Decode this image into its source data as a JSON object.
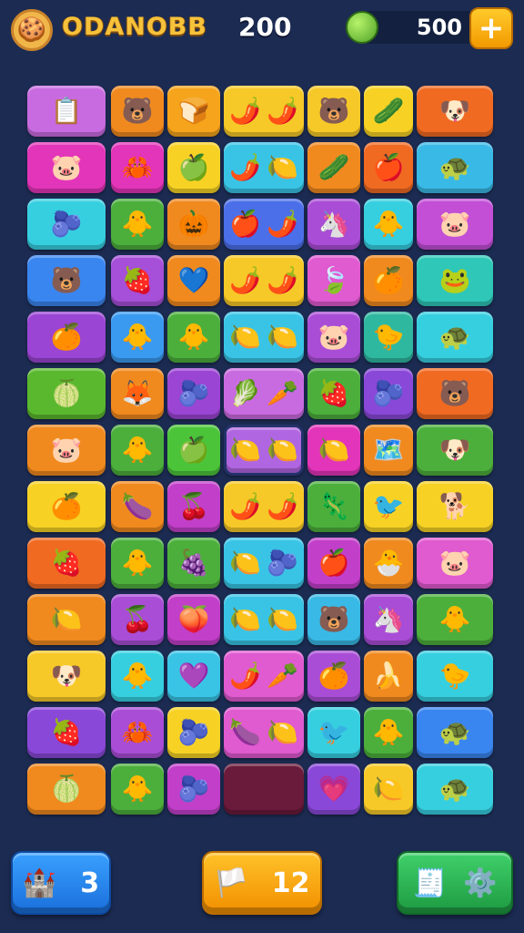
{
  "header": {
    "avatar_icon": "🍪",
    "title": "ODANOBB",
    "score": "200",
    "coins": "500",
    "add_label": "+"
  },
  "board": {
    "rows": [
      [
        {
          "c": "#c96be0",
          "g": [
            "📋"
          ],
          "n": "chart-board-icon"
        },
        {
          "c": "#f08a1f",
          "g": [
            "🐻"
          ],
          "n": "bear-icon"
        },
        {
          "c": "#f5a41c",
          "g": [
            "🍞"
          ],
          "n": "bread-icon"
        },
        {
          "c": "#f7c928",
          "g": [
            "🌶️",
            "🌶️"
          ],
          "n": "pepper-pair-icon"
        },
        {
          "c": "#f7c928",
          "g": [
            "🐻"
          ],
          "n": "bear-icon"
        },
        {
          "c": "#f7d225",
          "g": [
            "🥒"
          ],
          "n": "melon-icon"
        },
        {
          "c": "#f06a22",
          "g": [
            "🐶"
          ],
          "n": "puppy-icon"
        }
      ],
      [
        {
          "c": "#e335b9",
          "g": [
            "🐷"
          ],
          "n": "pig-icon"
        },
        {
          "c": "#e335b9",
          "g": [
            "🦀"
          ],
          "n": "crab-icon"
        },
        {
          "c": "#f7d225",
          "g": [
            "🍏"
          ],
          "n": "green-apple-icon"
        },
        {
          "c": "#39c4e6",
          "g": [
            "🌶️",
            "🍋"
          ],
          "n": "pepper-lemon-icon"
        },
        {
          "c": "#f08a1f",
          "g": [
            "🥒"
          ],
          "n": "cucumber-icon"
        },
        {
          "c": "#f06a22",
          "g": [
            "🍎"
          ],
          "n": "apple-icon"
        },
        {
          "c": "#39b9e6",
          "g": [
            "🐢"
          ],
          "n": "turtle-icon"
        }
      ],
      [
        {
          "c": "#36cfe0",
          "g": [
            "🫐"
          ],
          "n": "berry-icon"
        },
        {
          "c": "#4caf3c",
          "g": [
            "🐥"
          ],
          "n": "chick-icon"
        },
        {
          "c": "#f08a1f",
          "g": [
            "🎃"
          ],
          "n": "pumpkin-icon"
        },
        {
          "c": "#4b6fe8",
          "g": [
            "🍎",
            "🌶️"
          ],
          "n": "apple-pepper-icon"
        },
        {
          "c": "#a94dd6",
          "g": [
            "🦄"
          ],
          "n": "critter-icon"
        },
        {
          "c": "#36cfe0",
          "g": [
            "🐥"
          ],
          "n": "chick-icon"
        },
        {
          "c": "#c24fd6",
          "g": [
            "🐷"
          ],
          "n": "pig-icon"
        }
      ],
      [
        {
          "c": "#3a86f0",
          "g": [
            "🐻"
          ],
          "n": "bear-icon"
        },
        {
          "c": "#a64fd8",
          "g": [
            "🍓"
          ],
          "n": "strawberry-icon"
        },
        {
          "c": "#f08a1f",
          "g": [
            "💙"
          ],
          "n": "heart-icon"
        },
        {
          "c": "#f7c928",
          "g": [
            "🌶️",
            "🌶️"
          ],
          "n": "pepper-pair-icon"
        },
        {
          "c": "#e05ad0",
          "g": [
            "🍃"
          ],
          "n": "leaf-icon"
        },
        {
          "c": "#f08a1f",
          "g": [
            "🍊"
          ],
          "n": "orange-icon"
        },
        {
          "c": "#2fc7b8",
          "g": [
            "🐸"
          ],
          "n": "frog-icon"
        }
      ],
      [
        {
          "c": "#9a45d3",
          "g": [
            "🍊"
          ],
          "n": "orange-icon"
        },
        {
          "c": "#3a9af0",
          "g": [
            "🐥"
          ],
          "n": "chick-icon"
        },
        {
          "c": "#4caf3c",
          "g": [
            "🐥"
          ],
          "n": "chick-icon"
        },
        {
          "c": "#39c4e6",
          "g": [
            "🍋",
            "🍋"
          ],
          "n": "lemon-pair-icon"
        },
        {
          "c": "#a94dd6",
          "g": [
            "🐷"
          ],
          "n": "pig-icon"
        },
        {
          "c": "#2fb8a0",
          "g": [
            "🐤"
          ],
          "n": "bird-icon"
        },
        {
          "c": "#36cfe0",
          "g": [
            "🐢"
          ],
          "n": "turtle-icon"
        }
      ],
      [
        {
          "c": "#5ab82e",
          "g": [
            "🍈"
          ],
          "n": "lime-icon"
        },
        {
          "c": "#f08a1f",
          "g": [
            "🦊"
          ],
          "n": "fox-icon"
        },
        {
          "c": "#9a45d3",
          "g": [
            "🫐"
          ],
          "n": "blueberry-icon"
        },
        {
          "c": "#c96be0",
          "g": [
            "🥬",
            "🥕"
          ],
          "n": "leaf-carrot-icon"
        },
        {
          "c": "#4caf3c",
          "g": [
            "🍓"
          ],
          "n": "strawberry-icon"
        },
        {
          "c": "#8a48d8",
          "g": [
            "🫐"
          ],
          "n": "blueberry-icon"
        },
        {
          "c": "#f06a22",
          "g": [
            "🐻"
          ],
          "n": "bear-icon"
        }
      ],
      [
        {
          "c": "#f08a1f",
          "g": [
            "🐷"
          ],
          "n": "pig-icon"
        },
        {
          "c": "#4caf3c",
          "g": [
            "🐥"
          ],
          "n": "chick-icon"
        },
        {
          "c": "#4cc43a",
          "g": [
            "🍏"
          ],
          "n": "green-apple-icon"
        },
        {
          "c": "#b066e0",
          "g": [
            "🍋",
            "🍋"
          ],
          "n": "lemon-pair-icon",
          "sel": true
        },
        {
          "c": "#e335b9",
          "g": [
            "🍋"
          ],
          "n": "lemon-icon"
        },
        {
          "c": "#f08a1f",
          "g": [
            "🗺️"
          ],
          "n": "map-card-icon"
        },
        {
          "c": "#4caf3c",
          "g": [
            "🐶"
          ],
          "n": "puppy-icon"
        }
      ],
      [
        {
          "c": "#f7d225",
          "g": [
            "🍊"
          ],
          "n": "orange-icon"
        },
        {
          "c": "#f08a1f",
          "g": [
            "🍆"
          ],
          "n": "eggplant-icon"
        },
        {
          "c": "#c23fc9",
          "g": [
            "🍒"
          ],
          "n": "cherry-icon"
        },
        {
          "c": "#f7c928",
          "g": [
            "🌶️",
            "🌶️"
          ],
          "n": "pepper-pair-icon"
        },
        {
          "c": "#4caf3c",
          "g": [
            "🦎"
          ],
          "n": "lizard-icon"
        },
        {
          "c": "#f7d225",
          "g": [
            "🐦"
          ],
          "n": "bird-icon"
        },
        {
          "c": "#f7d225",
          "g": [
            "🐕"
          ],
          "n": "dog-icon"
        }
      ],
      [
        {
          "c": "#f06a22",
          "g": [
            "🍓"
          ],
          "n": "strawberry-icon"
        },
        {
          "c": "#4caf3c",
          "g": [
            "🐥"
          ],
          "n": "chick-icon"
        },
        {
          "c": "#4caf3c",
          "g": [
            "🍇"
          ],
          "n": "plum-icon"
        },
        {
          "c": "#39c4e6",
          "g": [
            "🍋",
            "🫐"
          ],
          "n": "lemon-berry-icon"
        },
        {
          "c": "#c23fc9",
          "g": [
            "🍎"
          ],
          "n": "apple-icon"
        },
        {
          "c": "#f08a1f",
          "g": [
            "🐣"
          ],
          "n": "hatchling-icon"
        },
        {
          "c": "#e05ad0",
          "g": [
            "🐷"
          ],
          "n": "pig-icon"
        }
      ],
      [
        {
          "c": "#f08a1f",
          "g": [
            "🍋"
          ],
          "n": "lemon-icon"
        },
        {
          "c": "#a94dd6",
          "g": [
            "🍒"
          ],
          "n": "cherry-icon"
        },
        {
          "c": "#c23fc9",
          "g": [
            "🍑"
          ],
          "n": "peach-icon"
        },
        {
          "c": "#39c4e6",
          "g": [
            "🍋",
            "🍋"
          ],
          "n": "lemon-pair-icon"
        },
        {
          "c": "#39b9e6",
          "g": [
            "🐻"
          ],
          "n": "bear-icon"
        },
        {
          "c": "#a94dd6",
          "g": [
            "🦄"
          ],
          "n": "critter-icon"
        },
        {
          "c": "#4caf3c",
          "g": [
            "🐥"
          ],
          "n": "chick-icon"
        }
      ],
      [
        {
          "c": "#f7c928",
          "g": [
            "🐶"
          ],
          "n": "puppy-icon"
        },
        {
          "c": "#36cfe0",
          "g": [
            "🐥"
          ],
          "n": "chick-icon"
        },
        {
          "c": "#39c4e6",
          "g": [
            "💜"
          ],
          "n": "heart-icon"
        },
        {
          "c": "#e05ad0",
          "g": [
            "🌶️",
            "🥕"
          ],
          "n": "pepper-carrot-icon"
        },
        {
          "c": "#a94dd6",
          "g": [
            "🍊"
          ],
          "n": "orange-icon"
        },
        {
          "c": "#f08a1f",
          "g": [
            "🍌"
          ],
          "n": "banana-icon"
        },
        {
          "c": "#36cfe0",
          "g": [
            "🐤"
          ],
          "n": "bird-icon"
        }
      ],
      [
        {
          "c": "#8a48d8",
          "g": [
            "🍓"
          ],
          "n": "strawberry-icon"
        },
        {
          "c": "#a94dd6",
          "g": [
            "🦀"
          ],
          "n": "crab-icon"
        },
        {
          "c": "#f7d225",
          "g": [
            "🫐"
          ],
          "n": "blueberry-icon"
        },
        {
          "c": "#e05ad0",
          "g": [
            "🍆",
            "🍋"
          ],
          "n": "eggplant-lemon-icon"
        },
        {
          "c": "#36cfe0",
          "g": [
            "🐦"
          ],
          "n": "bird-icon"
        },
        {
          "c": "#4caf3c",
          "g": [
            "🐥"
          ],
          "n": "chick-icon"
        },
        {
          "c": "#3a86f0",
          "g": [
            "🐢"
          ],
          "n": "turtle-icon"
        }
      ],
      [
        {
          "c": "#f08a1f",
          "g": [
            "🍈"
          ],
          "n": "lime-icon"
        },
        {
          "c": "#4caf3c",
          "g": [
            "🐥"
          ],
          "n": "chick-icon"
        },
        {
          "c": "#c23fc9",
          "g": [
            "🫐"
          ],
          "n": "blueberry-icon"
        },
        {
          "c": "#6a1a3a",
          "g": [],
          "n": "empty-slot"
        },
        {
          "c": "#8a48d8",
          "g": [
            "💗"
          ],
          "n": "heart-icon"
        },
        {
          "c": "#f7c928",
          "g": [
            "🍋"
          ],
          "n": "lemon-icon"
        },
        {
          "c": "#36cfe0",
          "g": [
            "🐢"
          ],
          "n": "turtle-icon"
        }
      ]
    ]
  },
  "footer": {
    "left_icon": "castle-icon",
    "left_count": "3",
    "mid_icon": "flag-icon",
    "mid_count": "12",
    "right_icon_1": "cash-register-icon",
    "right_icon_2": "gear-icon"
  }
}
